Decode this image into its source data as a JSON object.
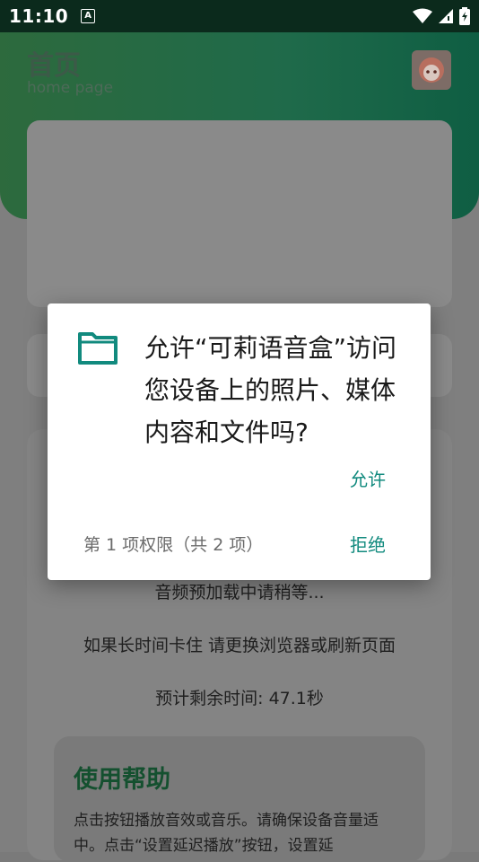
{
  "status_bar": {
    "time": "11:10",
    "notification_icon": "A",
    "icons": [
      "wifi-icon",
      "signal-icon",
      "battery-icon"
    ]
  },
  "header": {
    "title": "首页",
    "subtitle": "home page"
  },
  "background": {
    "loading_text": "音频预加载中请稍等...",
    "hint_text": "如果长时间卡住 请更换浏览器或刷新页面",
    "eta_text": "预计剩余时间: 47.1秒",
    "help": {
      "title": "使用帮助",
      "body": "点击按钮播放音效或音乐。请确保设备音量适中。点击“设置延迟播放”按钮，设置延"
    }
  },
  "dialog": {
    "message": "允许“可莉语音盒”访问您设备上的照片、媒体内容和文件吗?",
    "allow_label": "允许",
    "deny_label": "拒绝",
    "permission_count": "第 1 项权限（共 2 项）"
  },
  "colors": {
    "accent": "#118a7e",
    "header_green": "#1f6a4a"
  }
}
